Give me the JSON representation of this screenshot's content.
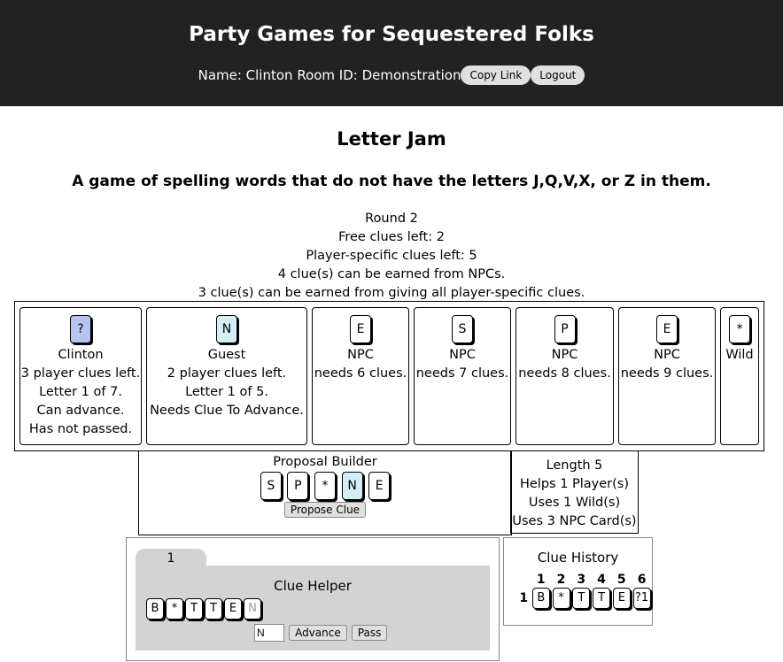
{
  "header": {
    "title": "Party Games for Sequestered Folks",
    "user_info": "Name: Clinton Room ID: Demonstration",
    "copy_link": "Copy Link",
    "logout": "Logout"
  },
  "game": {
    "title": "Letter Jam",
    "subtitle": "A game of spelling words that do not have the letters J,Q,V,X, or Z in them."
  },
  "status": {
    "round": "Round 2",
    "free_clues": "Free clues left: 2",
    "player_clues": "Player-specific clues left: 5",
    "npc_earn": "4 clue(s) can be earned from NPCs.",
    "player_earn": "3 clue(s) can be earned from giving all player-specific clues."
  },
  "players": [
    {
      "card": "?",
      "name": "Clinton",
      "lines": [
        "3 player clues left.",
        "Letter 1 of 7.",
        "Can advance.",
        "Has not passed."
      ]
    },
    {
      "card": "N",
      "name": "Guest",
      "lines": [
        "2 player clues left.",
        "Letter 1 of 5.",
        "Needs Clue To Advance."
      ]
    },
    {
      "card": "E",
      "name": "NPC",
      "lines": [
        "needs 6 clues."
      ]
    },
    {
      "card": "S",
      "name": "NPC",
      "lines": [
        "needs 7 clues."
      ]
    },
    {
      "card": "P",
      "name": "NPC",
      "lines": [
        "needs 8 clues."
      ]
    },
    {
      "card": "E",
      "name": "NPC",
      "lines": [
        "needs 9 clues."
      ]
    },
    {
      "card": "*",
      "name": "Wild",
      "lines": []
    }
  ],
  "builder": {
    "label": "Proposal Builder",
    "cards": [
      "S",
      "P",
      "*",
      "N",
      "E"
    ],
    "propose": "Propose Clue"
  },
  "stats": [
    "Length 5",
    "Helps 1 Player(s)",
    "Uses 1 Wild(s)",
    "Uses 3 NPC Card(s)"
  ],
  "helper": {
    "tab": "1",
    "title": "Clue Helper",
    "cards": [
      "B",
      "*",
      "T",
      "T",
      "E",
      "N"
    ],
    "input_value": "N",
    "advance": "Advance",
    "pass": "Pass"
  },
  "history": {
    "title": "Clue History",
    "columns": [
      "1",
      "2",
      "3",
      "4",
      "5",
      "6"
    ],
    "row_label": "1",
    "row": [
      "B",
      "*",
      "T",
      "T",
      "E",
      "?1"
    ]
  },
  "colors": {
    "header_bg": "#222222",
    "unknown_card": "#b8c4f0",
    "highlight_card": "#d4eef8",
    "panel_gray": "#d3d3d3"
  }
}
